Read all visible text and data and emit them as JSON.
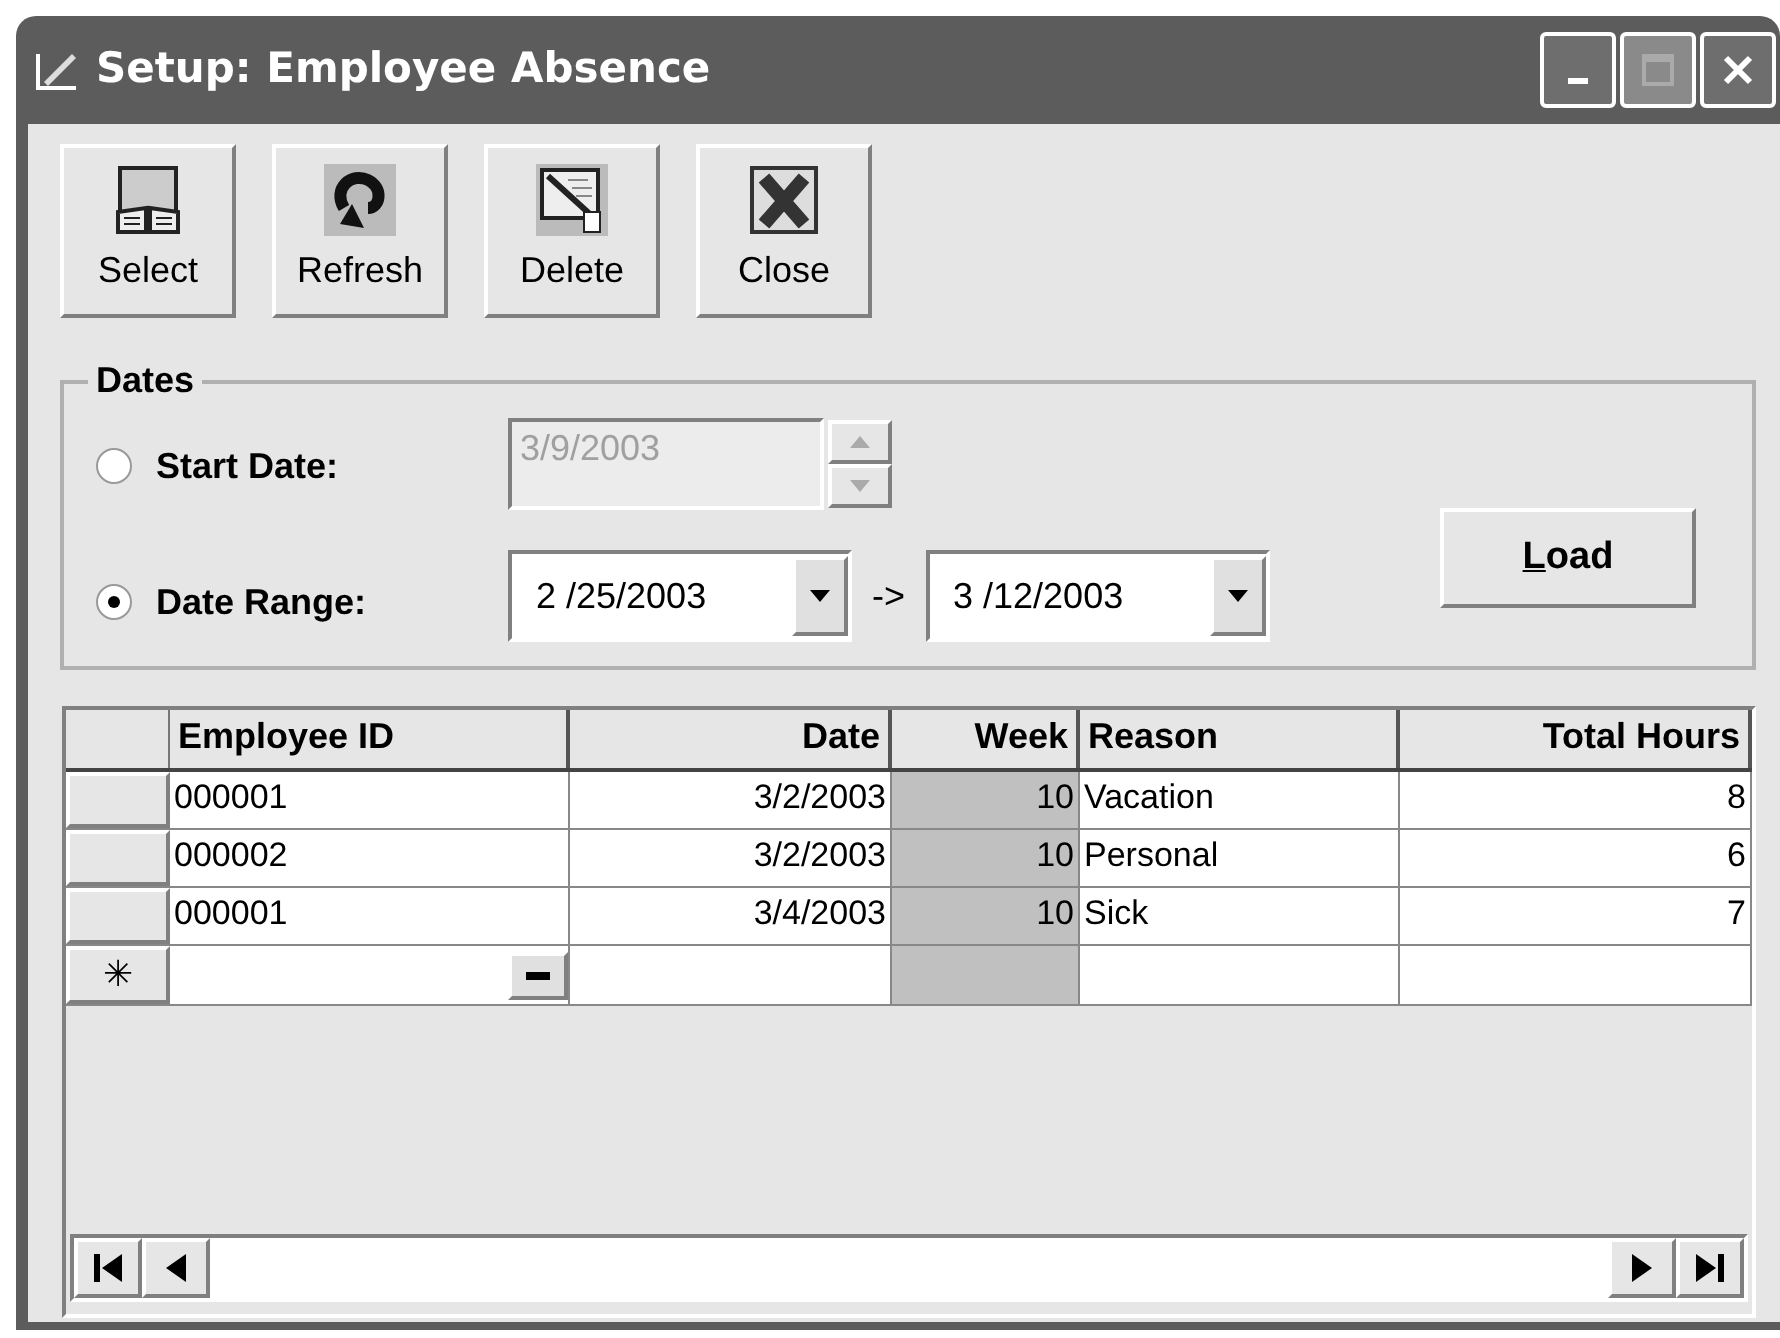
{
  "window": {
    "title": "Setup: Employee Absence",
    "controls": [
      {
        "kind": "minimize",
        "disabled": false
      },
      {
        "kind": "maximize",
        "disabled": true
      },
      {
        "kind": "close",
        "disabled": false
      }
    ]
  },
  "toolbar": [
    {
      "kind": "select",
      "label": "Select"
    },
    {
      "kind": "refresh",
      "label": "Refresh"
    },
    {
      "kind": "delete",
      "label": "Delete"
    },
    {
      "kind": "close",
      "label": "Close"
    }
  ],
  "dates": {
    "title": "Dates",
    "options": [
      {
        "label": "Start Date:",
        "selected": false
      },
      {
        "label": "Date Range:",
        "selected": true
      }
    ],
    "start_date": {
      "value": "3/9/2003",
      "disabled": true
    },
    "range": {
      "from": "2 /25/2003",
      "separator": "->",
      "to": "3 /12/2003"
    },
    "load_button": {
      "label": "Load"
    }
  },
  "grid": {
    "columns": [
      {
        "label": "Employee ID",
        "readonly": false
      },
      {
        "label": "Date",
        "readonly": false
      },
      {
        "label": "Week",
        "readonly": true
      },
      {
        "label": "Reason",
        "readonly": false
      },
      {
        "label": "Total Hours",
        "readonly": false
      }
    ],
    "rows": [
      [
        "000001",
        "3/2/2003",
        "10",
        "Vacation",
        "8"
      ],
      [
        "000002",
        "3/2/2003",
        "10",
        "Personal",
        "6"
      ],
      [
        "000001",
        "3/4/2003",
        "10",
        "Sick",
        "7"
      ]
    ],
    "new_row_marker": "✳"
  }
}
